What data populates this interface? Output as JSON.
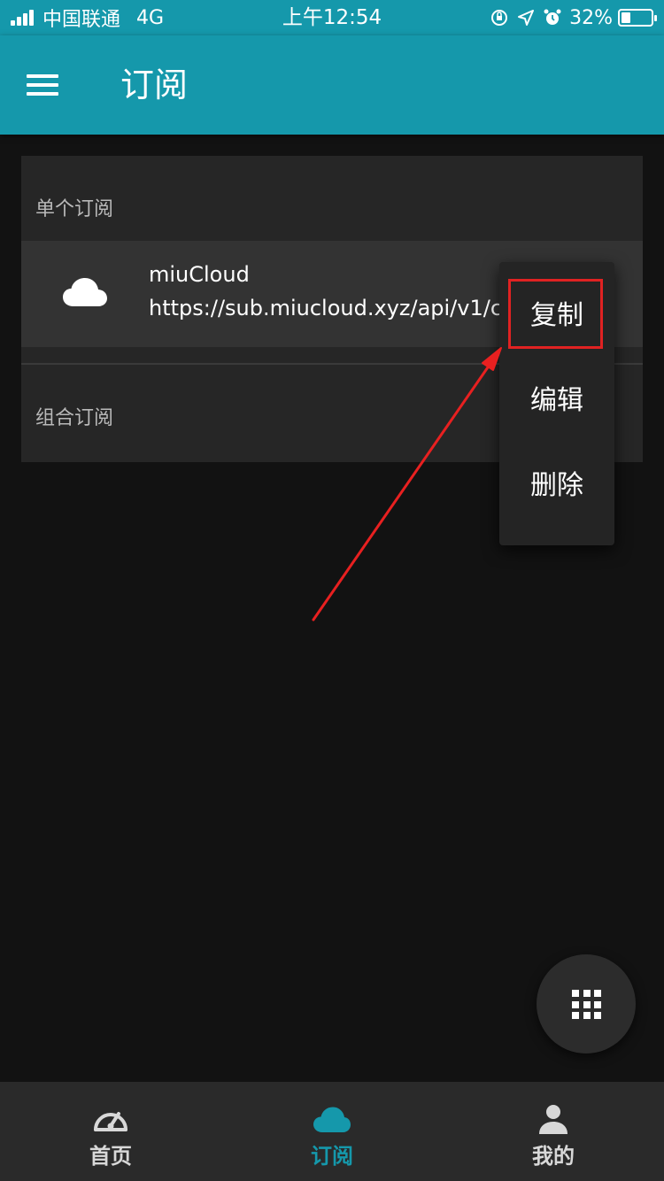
{
  "status_bar": {
    "carrier": "中国联通",
    "network": "4G",
    "time": "上午12:54",
    "battery": "32%",
    "battery_level": 0.32
  },
  "app_bar": {
    "title": "订阅",
    "menu_icon": "hamburger-menu-icon"
  },
  "sections": {
    "single": {
      "label": "单个订阅"
    },
    "combo": {
      "label": "组合订阅"
    }
  },
  "subscription": {
    "icon": "cloud-icon",
    "name": "miuCloud",
    "url": "https://sub.miucloud.xyz/api/v1/c"
  },
  "context_menu": {
    "copy": "复制",
    "edit": "编辑",
    "delete": "删除"
  },
  "fab": {
    "icon": "grid-icon"
  },
  "bottom_nav": {
    "items": [
      {
        "label": "首页",
        "icon": "speedometer-icon"
      },
      {
        "label": "订阅",
        "icon": "cloud-icon",
        "active": true
      },
      {
        "label": "我的",
        "icon": "person-icon"
      }
    ]
  },
  "colors": {
    "primary": "#1598ab",
    "background": "#121212",
    "card": "#262626",
    "highlight": "#e02222"
  }
}
